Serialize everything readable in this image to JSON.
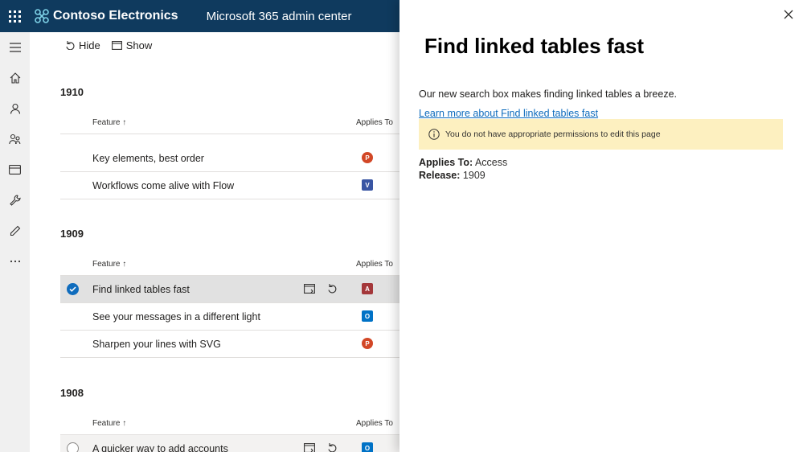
{
  "header": {
    "brand": "Contoso Electronics",
    "app_name": "Microsoft 365 admin center",
    "bg_color": "#0f3a5e"
  },
  "rail": {
    "items": [
      "hamburger-menu-icon",
      "home-icon",
      "user-icon",
      "groups-icon",
      "billing-icon",
      "setup-wrench-icon",
      "edit-pen-icon",
      "more-icon"
    ]
  },
  "commands": {
    "hide": "Hide",
    "show": "Show"
  },
  "columns": {
    "feature": "Feature",
    "applies_to": "Applies To"
  },
  "sections": [
    {
      "title": "1910",
      "rows": [
        {
          "label": "Key elements, best order",
          "app": "PowerPoint"
        },
        {
          "label": "Workflows come alive with Flow",
          "app": "Visio"
        }
      ]
    },
    {
      "title": "1909",
      "rows": [
        {
          "label": "Find linked tables fast",
          "app": "Access",
          "selected": true
        },
        {
          "label": "See your messages in a different light",
          "app": "Outlook"
        },
        {
          "label": "Sharpen your lines with SVG",
          "app": "PowerPoint"
        }
      ]
    },
    {
      "title": "1908",
      "rows": [
        {
          "label": "A quicker way to add accounts",
          "app": "Outlook"
        }
      ]
    }
  ],
  "panel": {
    "title": "Find linked tables fast",
    "description": "Our new search box makes finding linked tables a breeze.",
    "link": "Learn more about Find linked tables fast",
    "warning": "You do not have appropriate permissions to edit this page",
    "applies_label": "Applies To:",
    "applies_value": "Access",
    "release_label": "Release:",
    "release_value": "1909"
  }
}
